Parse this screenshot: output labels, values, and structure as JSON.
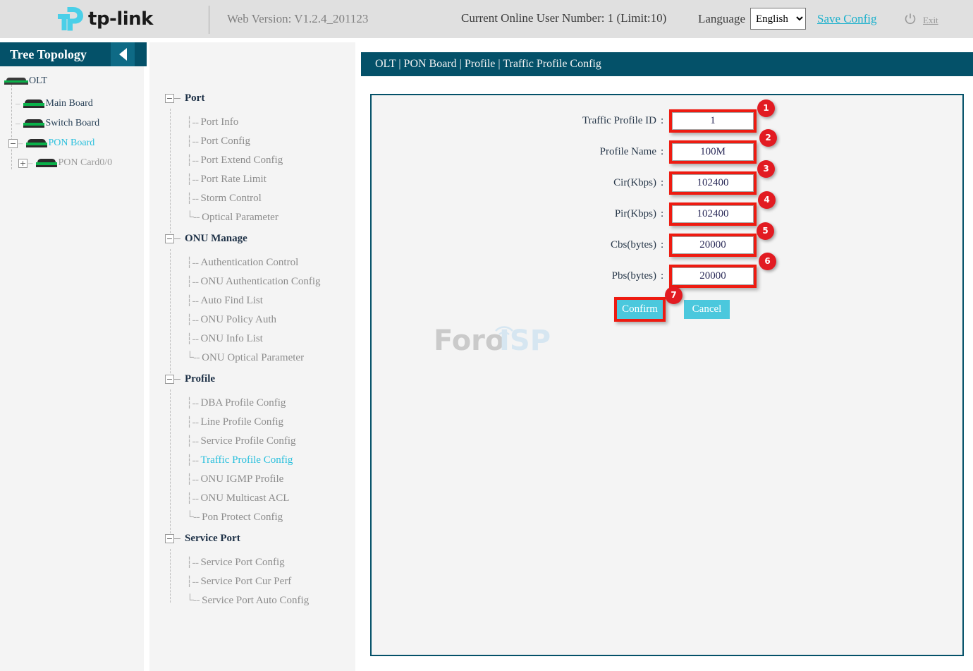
{
  "header": {
    "brand": "tp-link",
    "web_version": "Web Version: V1.2.4_201123",
    "online_users": "Current Online User Number: 1 (Limit:10)",
    "language_label": "Language",
    "language_value": "English",
    "language_options": [
      "English"
    ],
    "save_config": "Save Config",
    "exit": "Exit"
  },
  "sidebar": {
    "title": "Tree Topology",
    "collapse_icon": "triangle-left-icon",
    "nodes": [
      {
        "label": "OLT",
        "state": "normal"
      },
      {
        "label": "Main Board",
        "state": "normal"
      },
      {
        "label": "Switch Board",
        "state": "normal"
      },
      {
        "label": "PON Board",
        "state": "active"
      },
      {
        "label": "PON Card0/0",
        "state": "muted"
      }
    ]
  },
  "menu": {
    "groups": [
      {
        "label": "Port",
        "toggle": "−",
        "items": [
          "Port Info",
          "Port Config",
          "Port Extend Config",
          "Port Rate Limit",
          "Storm Control",
          "Optical Parameter"
        ]
      },
      {
        "label": "ONU Manage",
        "toggle": "−",
        "items": [
          "Authentication Control",
          "ONU Authentication Config",
          "Auto Find List",
          "ONU Policy Auth",
          "ONU Info List",
          "ONU Optical Parameter"
        ]
      },
      {
        "label": "Profile",
        "toggle": "−",
        "items": [
          "DBA Profile Config",
          "Line Profile Config",
          "Service Profile Config",
          "Traffic Profile Config",
          "ONU IGMP Profile",
          "ONU Multicast ACL",
          "Pon Protect Config"
        ]
      },
      {
        "label": "Service Port",
        "toggle": "−",
        "items": [
          "Service Port Config",
          "Service Port Cur Perf",
          "Service Port Auto Config"
        ]
      }
    ],
    "selected_item": "Traffic Profile Config"
  },
  "main": {
    "breadcrumb": "OLT | PON Board | Profile | Traffic Profile Config",
    "watermark": {
      "part1": "Foro",
      "part2": "ISP"
    },
    "form": {
      "fields": [
        {
          "label": "Traffic Profile ID",
          "colon": ":",
          "value": "1",
          "badge": "1"
        },
        {
          "label": "Profile Name",
          "colon": ":",
          "value": "100M",
          "badge": "2"
        },
        {
          "label": "Cir(Kbps)",
          "colon": ":",
          "value": "102400",
          "badge": "3"
        },
        {
          "label": "Pir(Kbps)",
          "colon": ":",
          "value": "102400",
          "badge": "4"
        },
        {
          "label": "Cbs(bytes)",
          "colon": ":",
          "value": "20000",
          "badge": "5"
        },
        {
          "label": "Pbs(bytes)",
          "colon": ":",
          "value": "20000",
          "badge": "6"
        }
      ],
      "confirm_label": "Confirm",
      "confirm_badge": "7",
      "cancel_label": "Cancel"
    }
  },
  "colors": {
    "brand_cyan": "#4acfe8",
    "teal_header": "#045169",
    "annotation_red": "#ee1b11",
    "badge_red": "#e21b22",
    "button_cyan": "#4bc8dd",
    "link_cyan": "#19b0cc",
    "page_gray": "#f4f4f4"
  }
}
